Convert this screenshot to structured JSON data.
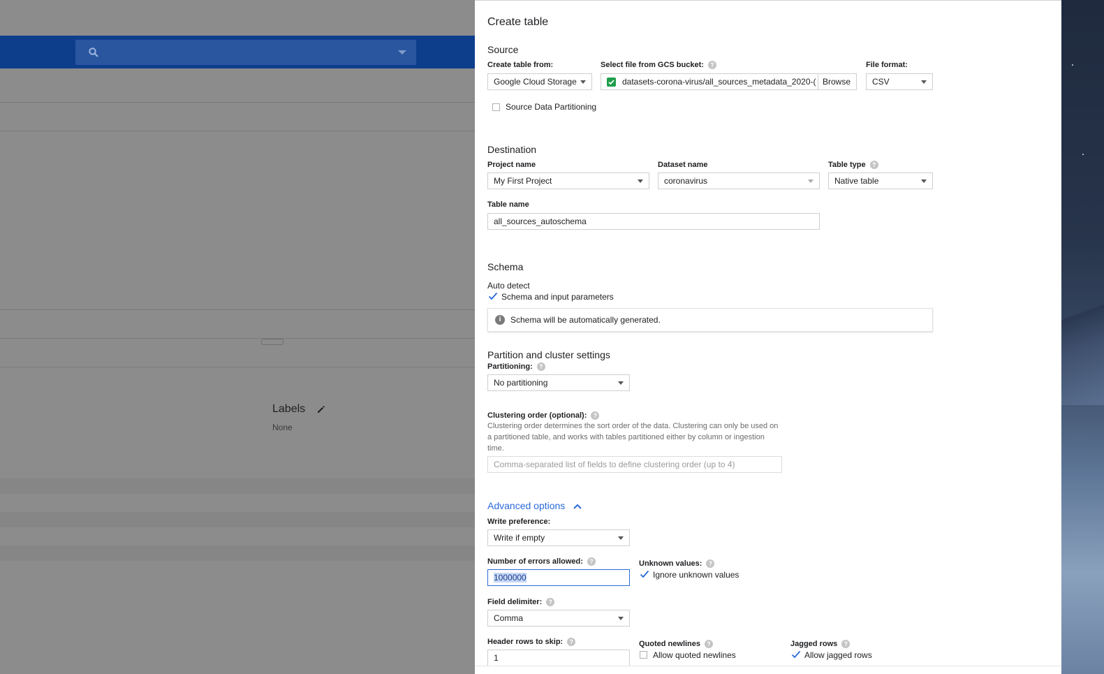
{
  "background": {
    "labels_title": "Labels",
    "labels_value": "None"
  },
  "panel": {
    "title": "Create table",
    "source": {
      "heading": "Source",
      "create_from_label": "Create table from:",
      "create_from_value": "Google Cloud Storage",
      "gcs_label": "Select file from GCS bucket:",
      "gcs_value": "datasets-corona-virus/all_sources_metadata_2020-(",
      "browse_label": "Browse",
      "format_label": "File format:",
      "format_value": "CSV",
      "partitioning_label": "Source Data Partitioning"
    },
    "destination": {
      "heading": "Destination",
      "project_label": "Project name",
      "project_value": "My First Project",
      "dataset_label": "Dataset name",
      "dataset_value": "coronavirus",
      "table_type_label": "Table type",
      "table_type_value": "Native table",
      "table_name_label": "Table name",
      "table_name_value": "all_sources_autoschema"
    },
    "schema": {
      "heading": "Schema",
      "auto_detect_label": "Auto detect",
      "auto_detect_checkbox": "Schema and input parameters",
      "auto_detect_checked": true,
      "info_text": "Schema will be automatically generated."
    },
    "partition": {
      "heading": "Partition and cluster settings",
      "partitioning_label": "Partitioning:",
      "partitioning_value": "No partitioning",
      "clustering_label": "Clustering order (optional):",
      "clustering_desc": "Clustering order determines the sort order of the data. Clustering can only be used on a partitioned table, and works with tables partitioned either by column or ingestion time.",
      "clustering_placeholder": "Comma-separated list of fields to define clustering order (up to 4)"
    },
    "advanced": {
      "toggle_label": "Advanced options",
      "write_pref_label": "Write preference:",
      "write_pref_value": "Write if empty",
      "errors_label": "Number of errors allowed:",
      "errors_value": "1000000",
      "unknown_label": "Unknown values:",
      "unknown_checkbox": "Ignore unknown values",
      "unknown_checked": true,
      "delimiter_label": "Field delimiter:",
      "delimiter_value": "Comma",
      "header_rows_label": "Header rows to skip:",
      "header_rows_value": "1",
      "quoted_label": "Quoted newlines",
      "quoted_checkbox": "Allow quoted newlines",
      "quoted_checked": false,
      "jagged_label": "Jagged rows",
      "jagged_checkbox": "Allow jagged rows",
      "jagged_checked": true
    }
  },
  "colors": {
    "accent": "#2a6ad9",
    "topbar": "#0d3e8c",
    "check_green": "#1e9e4a"
  },
  "icons": {
    "search": "search-icon",
    "dropdown": "chevron-down-icon",
    "edit": "pencil-icon",
    "help": "help-icon",
    "info": "info-icon",
    "collapse": "chevron-up-icon"
  }
}
